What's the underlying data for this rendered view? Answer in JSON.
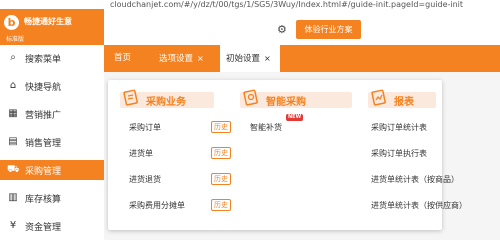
{
  "browser": {
    "url_fragment": "cloudchanjet.com/#/y/dz/t/00/tgs/1/SG5/3Wuy/Index.html#/guide-init.pageId=guide-init"
  },
  "app": {
    "logo_mark": "b",
    "name": "畅捷通好生意",
    "version": "标准版",
    "address_placeholder": "",
    "experience_button": "体验行业方案"
  },
  "icons": {
    "search": "search-menu-icon",
    "nav": "home-icon",
    "marketing": "shop-icon",
    "sales": "sales-icon",
    "purchase": "cart-icon",
    "inventory": "inventory-icon",
    "finance": "money-icon",
    "settings": "gear-icon"
  },
  "sidebar": {
    "items": [
      {
        "label": "搜索菜单",
        "icon": "⌕"
      },
      {
        "label": "快捷导航",
        "icon": "⌂"
      },
      {
        "label": "营销推广",
        "icon": "▦"
      },
      {
        "label": "销售管理",
        "icon": "▤"
      },
      {
        "label": "采购管理",
        "icon": "⛟"
      },
      {
        "label": "库存核算",
        "icon": "▥"
      },
      {
        "label": "资金管理",
        "icon": "¥"
      }
    ]
  },
  "tabs": [
    {
      "label": "首页"
    },
    {
      "label": "选项设置",
      "close": "×"
    },
    {
      "label": "初始设置",
      "close": "×"
    }
  ],
  "panel": {
    "columns": [
      {
        "title": "采购业务",
        "links": [
          {
            "label": "采购订单",
            "tag": "历史"
          },
          {
            "label": "进货单",
            "tag": "历史"
          },
          {
            "label": "进货退货",
            "tag": "历史"
          },
          {
            "label": "采购费用分摊单",
            "tag": "历史"
          }
        ]
      },
      {
        "title": "智能采购",
        "links": [
          {
            "label": "智能补货",
            "badge": "NEW"
          }
        ]
      },
      {
        "title": "报表",
        "links": [
          {
            "label": "采购订单统计表"
          },
          {
            "label": "采购订单执行表"
          },
          {
            "label": "进货单统计表（按商品）"
          },
          {
            "label": "进货单统计表（按供应商）"
          }
        ]
      }
    ]
  },
  "colors": {
    "accent": "#f58220",
    "accent_light": "#fbe9de",
    "badge": "#e53935"
  }
}
